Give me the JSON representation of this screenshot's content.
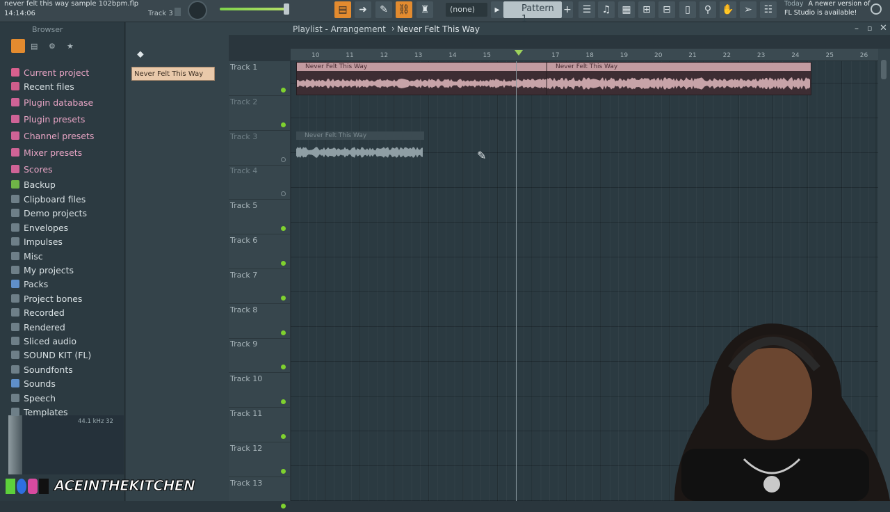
{
  "topbar": {
    "filename": "never felt this way sample 102bpm.flp",
    "time": "14:14:06",
    "track_hint": "Track 3",
    "pattern_select": "(none)",
    "pattern_label": "Pattern 1",
    "news_day": "Today",
    "news_line1": "A newer version of",
    "news_line2": "FL Studio is available!"
  },
  "browser": {
    "label": "Browser",
    "items": [
      {
        "label": "Current project",
        "pink": true,
        "color": "#d9608e"
      },
      {
        "label": "Recent files",
        "pink": false,
        "color": "#cf5d8b"
      },
      {
        "label": "Plugin database",
        "pink": true,
        "color": "#cf6396"
      },
      {
        "label": "Plugin presets",
        "pink": true,
        "color": "#cf6396"
      },
      {
        "label": "Channel presets",
        "pink": true,
        "color": "#cf6396"
      },
      {
        "label": "Mixer presets",
        "pink": true,
        "color": "#cf6396"
      },
      {
        "label": "Scores",
        "pink": true,
        "color": "#cf6396"
      },
      {
        "label": "Backup",
        "pink": false,
        "color": "#6fb447"
      },
      {
        "label": "Clipboard files",
        "pink": false,
        "color": "#6e7f88"
      },
      {
        "label": "Demo projects",
        "pink": false,
        "color": "#6e7f88"
      },
      {
        "label": "Envelopes",
        "pink": false,
        "color": "#6e7f88"
      },
      {
        "label": "Impulses",
        "pink": false,
        "color": "#6e7f88"
      },
      {
        "label": "Misc",
        "pink": false,
        "color": "#6e7f88"
      },
      {
        "label": "My projects",
        "pink": false,
        "color": "#6e7f88"
      },
      {
        "label": "Packs",
        "pink": false,
        "color": "#5f8fc9"
      },
      {
        "label": "Project bones",
        "pink": false,
        "color": "#6e7f88"
      },
      {
        "label": "Recorded",
        "pink": false,
        "color": "#6e7f88"
      },
      {
        "label": "Rendered",
        "pink": false,
        "color": "#6e7f88"
      },
      {
        "label": "Sliced audio",
        "pink": false,
        "color": "#6e7f88"
      },
      {
        "label": "SOUND KIT (FL)",
        "pink": false,
        "color": "#6e7f88"
      },
      {
        "label": "Soundfonts",
        "pink": false,
        "color": "#6e7f88"
      },
      {
        "label": "Sounds",
        "pink": false,
        "color": "#5f8fc9"
      },
      {
        "label": "Speech",
        "pink": false,
        "color": "#6e7f88"
      },
      {
        "label": "Templates",
        "pink": false,
        "color": "#6e7f88"
      }
    ],
    "preview_info": "44.1 kHz 32"
  },
  "pattern_list": {
    "selected": "Never Felt This Way"
  },
  "playlist": {
    "breadcrumb_root": "Playlist - Arrangement",
    "breadcrumb_item": "Never Felt This Way",
    "ruler": [
      "10",
      "11",
      "12",
      "13",
      "14",
      "15",
      "",
      "17",
      "18",
      "19",
      "20",
      "21",
      "22",
      "23",
      "24",
      "25",
      "26"
    ],
    "tracks": [
      "Track 1",
      "Track 2",
      "Track 3",
      "Track 4",
      "Track 5",
      "Track 6",
      "Track 7",
      "Track 8",
      "Track 9",
      "Track 10",
      "Track 11",
      "Track 12",
      "Track 13"
    ],
    "clips": [
      {
        "title": "Never Felt This Way"
      },
      {
        "title": "Never Felt This Way"
      },
      {
        "title": "Never Felt This Way"
      }
    ]
  },
  "overlay": {
    "channel": "ACEINTHEKITCHEN"
  },
  "colors": {
    "accent": "#e38b2f",
    "clip_audio": "#c9a3a8",
    "led": "#7fd12f"
  }
}
